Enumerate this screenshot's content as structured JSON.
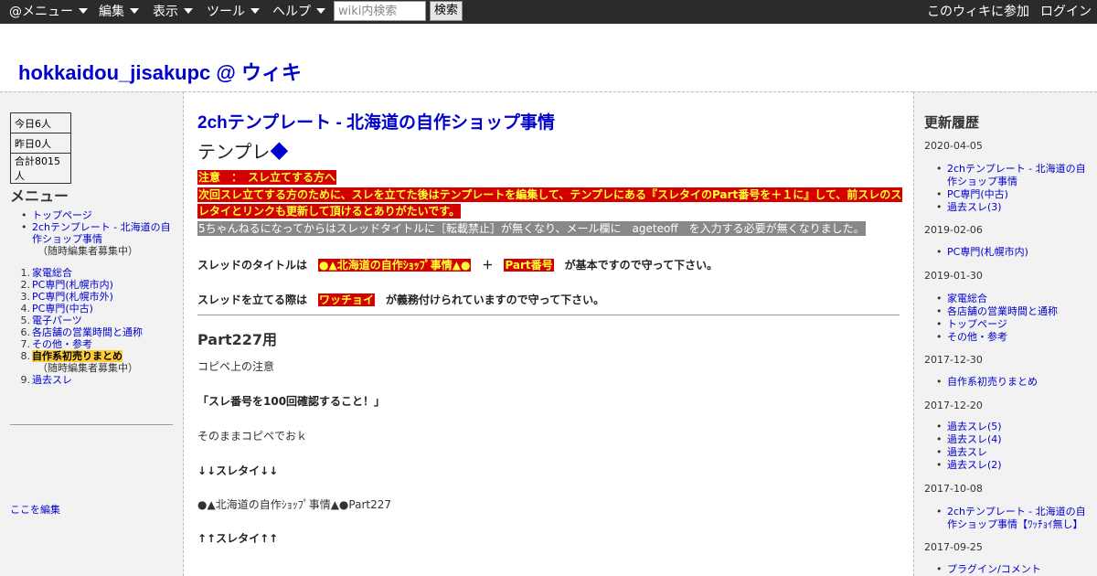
{
  "topbar": {
    "menus": [
      "@メニュー",
      "編集",
      "表示",
      "ツール",
      "ヘルプ"
    ],
    "search_placeholder": "wiki内検索",
    "search_button": "検索",
    "join": "このウィキに参加",
    "login": "ログイン"
  },
  "header": {
    "site_title": "hokkaidou_jisakupc @ ウィキ"
  },
  "left": {
    "counter": [
      "今日6人",
      "昨日0人",
      "合計8015人"
    ],
    "menu_title": "メニュー",
    "bullets": [
      {
        "label": "トップページ"
      },
      {
        "label": "2chテンプレート - 北海道の自作ショップ事情",
        "note": "（随時編集者募集中）"
      }
    ],
    "numbered": [
      {
        "num": "1.",
        "label": "家電総合"
      },
      {
        "num": "2.",
        "label": "PC専門(札幌市内)"
      },
      {
        "num": "3.",
        "label": "PC専門(札幌市外)"
      },
      {
        "num": "4.",
        "label": "PC専門(中古)"
      },
      {
        "num": "5.",
        "label": "電子パーツ"
      },
      {
        "num": "6.",
        "label": "各店舗の営業時間と通称"
      },
      {
        "num": "7.",
        "label": "その他・参考"
      },
      {
        "num": "8.",
        "label": "自作系初売りまとめ",
        "note": "（随時編集者募集中）"
      },
      {
        "num": "9.",
        "label": "過去スレ"
      }
    ],
    "edit_link": "ここを編集"
  },
  "main": {
    "page_title": "2chテンプレート - 北海道の自作ショップ事情",
    "heading": "テンプレ",
    "heading_mark": "◆",
    "notice_1": "注意　：　スレ立てする方へ",
    "notice_2": "次回スレ立てする方のために、スレを立てた後はテンプレートを編集して、テンプレにある『スレタイのPart番号を＋１に』して、前スレのス",
    "notice_3": "レタイとリンクも更新して頂けるとありがたいです。",
    "notice_gray": "5ちゃんねるになってからはスレッドタイトルに［転載禁止］が無くなり、メール欄に　ageteoff　を入力する必要が無くなりました。",
    "title_rule_pre": "スレッドのタイトルは　",
    "title_rule_mark1": "●▲北海道の自作ｼｮｯﾌﾟ事情▲●",
    "title_rule_plus": "　＋　",
    "title_rule_mark2": "Part番号",
    "title_rule_post": "　が基本ですので守って下さい。",
    "thread_rule_pre": "スレッドを立てる際は　",
    "thread_rule_mark": "ワッチョイ",
    "thread_rule_post": "　が義務付けられていますので守って下さい。",
    "part_heading": "Part227用",
    "copy_note": "コピペ上の注意",
    "check_note": "「スレ番号を100回確認すること！」",
    "copy_ok": "そのままコピペでおｋ",
    "down_marker": "↓↓スレタイ↓↓",
    "thread_title": "●▲北海道の自作ｼｮｯﾌﾟ事情▲●Part227",
    "up_marker": "↑↑スレタイ↑↑"
  },
  "right": {
    "title": "更新履歴",
    "groups": [
      {
        "date": "2020-04-05",
        "items": [
          "2chテンプレート - 北海道の自作ショップ事情",
          "PC専門(中古)",
          "過去スレ(3)"
        ]
      },
      {
        "date": "2019-02-06",
        "items": [
          "PC専門(札幌市内)"
        ]
      },
      {
        "date": "2019-01-30",
        "items": [
          "家電総合",
          "各店舗の営業時間と通称",
          "トップページ",
          "その他・参考"
        ]
      },
      {
        "date": "2017-12-30",
        "items": [
          "自作系初売りまとめ"
        ]
      },
      {
        "date": "2017-12-20",
        "items": [
          "過去スレ(5)",
          "過去スレ(4)",
          "過去スレ",
          "過去スレ(2)"
        ]
      },
      {
        "date": "2017-10-08",
        "items": [
          "2chテンプレート - 北海道の自作ショップ事情【ﾜｯﾁｮｲ無し】"
        ]
      },
      {
        "date": "2017-09-25",
        "items": [
          "プラグイン/コメント"
        ]
      }
    ]
  }
}
